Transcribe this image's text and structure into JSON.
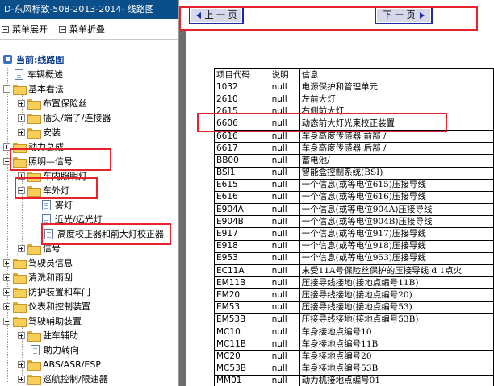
{
  "window": {
    "title": "D-东风标致-508-2013-2014- 线路图"
  },
  "menu": {
    "expand_label": "菜单展开",
    "collapse_label": "菜单折叠"
  },
  "tree": {
    "root": "当前:线路图",
    "items": [
      {
        "label": "车辆概述"
      },
      {
        "label": "基本看法"
      },
      {
        "label": "布置保险丝"
      },
      {
        "label": "插头/端子/连接器"
      },
      {
        "label": "安装"
      },
      {
        "label": "动力总成"
      },
      {
        "label": "照明—信号"
      },
      {
        "label": "车内照明灯"
      },
      {
        "label": "车外灯"
      },
      {
        "label": "雾灯"
      },
      {
        "label": "近光/远光灯"
      },
      {
        "label": "高度校正器和前大灯校正器"
      },
      {
        "label": "信号"
      },
      {
        "label": "驾驶员信息"
      },
      {
        "label": "清洗和雨刮"
      },
      {
        "label": "防护装置和车门"
      },
      {
        "label": "仪表和控制装置"
      },
      {
        "label": "驾驶辅助装置"
      },
      {
        "label": "驻车辅助"
      },
      {
        "label": "助力转向"
      },
      {
        "label": "ABS/ASR/ESP"
      },
      {
        "label": "巡航控制/限速器"
      }
    ]
  },
  "nav": {
    "prev_label": "上 一 页",
    "next_label": "下 一 页"
  },
  "table": {
    "headers": [
      "项目代码",
      "说明",
      "信息"
    ],
    "rows": [
      [
        "1032",
        "null",
        "电源保护和管理单元"
      ],
      [
        "2610",
        "null",
        "左前大灯"
      ],
      [
        "2615",
        "null",
        "右侧前大灯"
      ],
      [
        "6606",
        "null",
        "动态前大灯光束校正装置"
      ],
      [
        "6616",
        "null",
        "车身高度传感器 前部 /"
      ],
      [
        "6617",
        "null",
        "车身高度传感器 后部 /"
      ],
      [
        "BB00",
        "null",
        "蓄电池/"
      ],
      [
        "BSI1",
        "null",
        "智能盒控制系统(BSI)"
      ],
      [
        "E615",
        "null",
        "一个信息(或等电位615)压接导线"
      ],
      [
        "E616",
        "null",
        "一个信息(或等电位616)压接导线"
      ],
      [
        "E904A",
        "null",
        "一个信息(或等电位904A)压接导线"
      ],
      [
        "E904B",
        "null",
        "一个信息(或等电位904B)压接导线"
      ],
      [
        "E917",
        "null",
        "一个信息(或等电位917)压接导线"
      ],
      [
        "E918",
        "null",
        "一个信息(或等电位918)压接导线"
      ],
      [
        "E953",
        "null",
        "一个信息(或等电位953)压接导线"
      ],
      [
        "EC11A",
        "null",
        "末受11A号保险丝保护的压接导线 d 1点火"
      ],
      [
        "EM11B",
        "null",
        "压接导线接地(接地点编号11B)"
      ],
      [
        "EM20",
        "null",
        "压接导线接地(接地点编号20)"
      ],
      [
        "EM53",
        "null",
        "压接导线接地(接地点编号53)"
      ],
      [
        "EM53B",
        "null",
        "压接导线接地(接地点编号53B)"
      ],
      [
        "MC10",
        "null",
        "车身接地点编号10"
      ],
      [
        "MC11B",
        "null",
        "车身接地点编号11B"
      ],
      [
        "MC20",
        "null",
        "车身接地点编号20"
      ],
      [
        "MC53B",
        "null",
        "车身接地点编号53B"
      ],
      [
        "MM01",
        "null",
        "动力机接地点编号01"
      ]
    ]
  },
  "colors": {
    "title_bg": "#0a4e8a",
    "highlight": "#e8232e",
    "nav_button": "#1d2aa6",
    "frame_bg": "#6d6d6d"
  }
}
